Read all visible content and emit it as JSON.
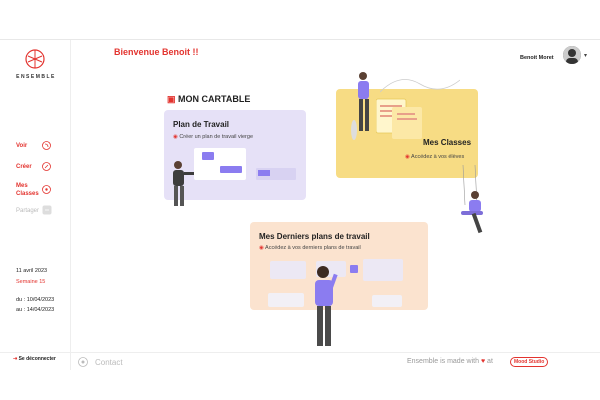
{
  "brand": "ENSEMBLE",
  "welcome": "Bienvenue Benoit !!",
  "user": "Benoit Moret",
  "nav": [
    {
      "label": "Voir",
      "icon": "rss-icon"
    },
    {
      "label": "Créer",
      "icon": "pen-icon"
    },
    {
      "label": "Mes Classes",
      "icon": "share-icon"
    },
    {
      "label": "Partager",
      "icon": "share-box-icon"
    }
  ],
  "dates": {
    "today": "11 avril 2023",
    "week": "Semaine 15",
    "from": "du : 10/04/2023",
    "to": "au : 14/04/2023"
  },
  "logout": "Se déconnecter",
  "main": {
    "title": "MON CARTABLE",
    "cards": [
      {
        "title": "Plan de Travail",
        "sub": "Créer un plan de travail vierge",
        "color": "#e6e1f7"
      },
      {
        "title": "Mes Classes",
        "sub": "Accédez à vos élèves",
        "color": "#f7dc84"
      },
      {
        "title": "Mes Derniers plans de travail",
        "sub": "Accédez à vos derniers plans de travail",
        "color": "#fbe3cf"
      }
    ]
  },
  "footer": {
    "contact": "Contact",
    "made": "Ensemble is made with",
    "at": "at",
    "studio": "Mood Studio"
  },
  "colors": {
    "accent": "#e3342f",
    "purple": "#8b7cf0"
  }
}
